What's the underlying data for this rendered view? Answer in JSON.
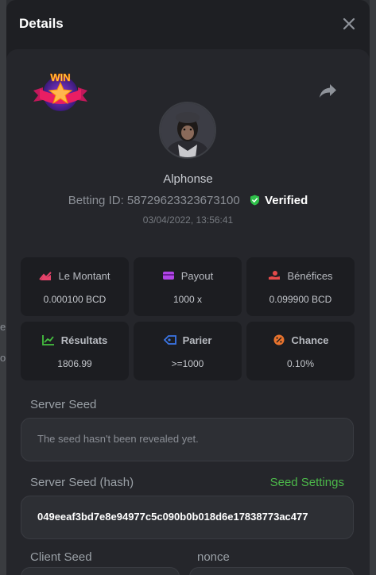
{
  "modal": {
    "title": "Details",
    "close_icon": "close-icon"
  },
  "background": {
    "peek_letter_1": "e",
    "peek_letter_2": "o"
  },
  "bet": {
    "badge_text": "WIN",
    "username": "Alphonse",
    "betting_id_label": "Betting ID: 58729623323673100",
    "verified_label": "Verified",
    "timestamp": "03/04/2022, 13:56:41"
  },
  "stats": [
    {
      "label": "Le Montant",
      "value": "0.000100 BCD",
      "icon": "amount-icon",
      "color": "#e6436a"
    },
    {
      "label": "Payout",
      "value": "1000 x",
      "icon": "card-icon",
      "color": "#b045e6"
    },
    {
      "label": "Bénéfices",
      "value": "0.099900 BCD",
      "icon": "profit-hand-icon",
      "color": "#e54a4a"
    },
    {
      "label": "Résultats",
      "value": "1806.99",
      "icon": "chart-icon",
      "color": "#45c040"
    },
    {
      "label": "Parier",
      "value": ">=1000",
      "icon": "tag-icon",
      "color": "#3b76e6"
    },
    {
      "label": "Chance",
      "value": "0.10%",
      "icon": "percent-icon",
      "color": "#e8732d"
    }
  ],
  "server_seed": {
    "label": "Server Seed",
    "value": "The seed hasn't been revealed yet."
  },
  "server_seed_hash": {
    "label": "Server Seed (hash)",
    "settings_link": "Seed Settings",
    "value": "049eeaf3bd7e8e94977c5c090b0b018d6e17838773ac477"
  },
  "client_seed": {
    "label": "Client Seed"
  },
  "nonce": {
    "label": "nonce"
  },
  "colors": {
    "accent_green": "#4cb94a",
    "verified_green": "#2fc04a"
  }
}
